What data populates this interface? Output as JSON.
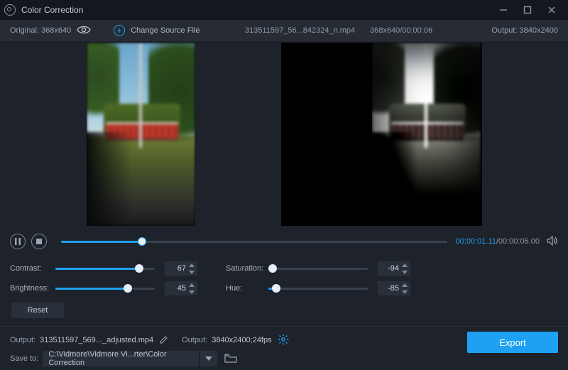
{
  "window": {
    "title": "Color Correction"
  },
  "topbar": {
    "original_label": "Original: 368x640",
    "change_source": "Change Source File",
    "filename": "313511597_56...842324_n.mp4",
    "dims_time": "368x640/00:00:06",
    "output_label": "Output: 3840x2400"
  },
  "transport": {
    "current_time": "00:00:01.11",
    "total_time": "/00:00:06.00",
    "progress_pct": 21
  },
  "sliders": {
    "contrast": {
      "label": "Contrast:",
      "value": "67",
      "pct": 84
    },
    "brightness": {
      "label": "Brightness:",
      "value": "45",
      "pct": 73
    },
    "saturation": {
      "label": "Saturation:",
      "value": "-94",
      "pct": 4
    },
    "hue": {
      "label": "Hue:",
      "value": "-85",
      "pct": 8
    }
  },
  "reset_label": "Reset",
  "bottom": {
    "output_label_1": "Output:",
    "output_filename": "313511597_569..._adjusted.mp4",
    "output_label_2": "Output:",
    "output_format": "3840x2400;24fps",
    "save_to_label": "Save to:",
    "save_to_path": "C:\\Vidmore\\Vidmore Vi...rter\\Color Correction",
    "export_label": "Export"
  }
}
